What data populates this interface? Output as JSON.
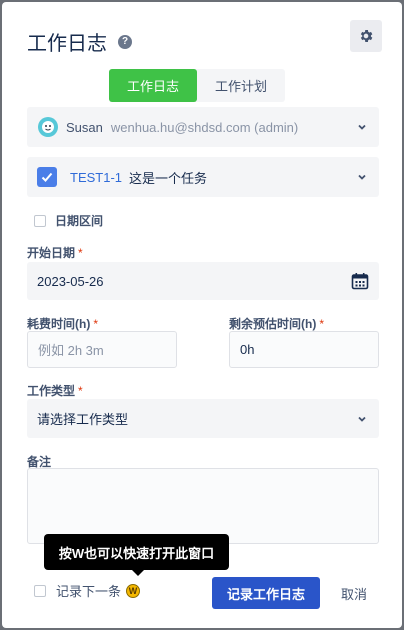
{
  "dialog": {
    "title": "工作日志",
    "help_icon": "?",
    "settings_icon": "gear-icon"
  },
  "tabs": [
    {
      "label": "工作日志",
      "active": true
    },
    {
      "label": "工作计划",
      "active": false
    }
  ],
  "user": {
    "name": "Susan",
    "email": "wenhua.hu@shdsd.com (admin)"
  },
  "task": {
    "checked": true,
    "key": "TEST1-1",
    "name": "这是一个任务"
  },
  "date_range": {
    "label": "日期区间",
    "checked": false
  },
  "start_date": {
    "label": "开始日期",
    "required": "*",
    "value": "2023-05-26"
  },
  "time_spent": {
    "label": "耗费时间(h)",
    "required": "*",
    "placeholder": "例如 2h 3m"
  },
  "remaining": {
    "label": "剩余预估时间(h)",
    "required": "*",
    "value": "0h"
  },
  "work_type": {
    "label": "工作类型",
    "required": "*",
    "placeholder": "请选择工作类型"
  },
  "notes": {
    "label": "备注"
  },
  "tooltip": {
    "text": "按W也可以快速打开此窗口",
    "bulb": "W"
  },
  "footer": {
    "record_next_label": "记录下一条",
    "submit_label": "记录工作日志",
    "cancel_label": "取消"
  },
  "colors": {
    "accent_green": "#3fc247",
    "primary_blue": "#2a55c9",
    "link_blue": "#2f6bd8",
    "required_red": "#de350b"
  }
}
